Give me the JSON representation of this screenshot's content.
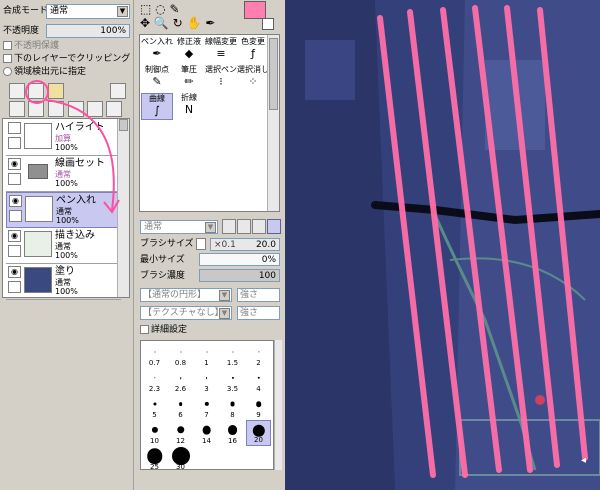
{
  "layer_panel": {
    "blend_mode_label": "合成モード",
    "blend_mode_value": "通常",
    "opacity_label": "不透明度",
    "opacity_value": "100%",
    "protect_opacity": "不透明保護",
    "clip_lower": "下のレイヤーでクリッピング",
    "selection_source": "領域検出元に指定",
    "layers": [
      {
        "name": "ハイライト",
        "mode": "加算",
        "opacity": "100%"
      },
      {
        "name": "線画セット",
        "mode": "通常",
        "opacity": "100%"
      },
      {
        "name": "ペン入れ",
        "mode": "通常",
        "opacity": "100%"
      },
      {
        "name": "描き込み",
        "mode": "通常",
        "opacity": "100%"
      },
      {
        "name": "塗り",
        "mode": "通常",
        "opacity": "100%"
      }
    ]
  },
  "tool_panel": {
    "tools": [
      {
        "label": "ペン入れ",
        "icon": "pen-icon"
      },
      {
        "label": "修正液",
        "icon": "correction-icon"
      },
      {
        "label": "線幅変更",
        "icon": "line-width-icon"
      },
      {
        "label": "色変更",
        "icon": "color-change-icon"
      },
      {
        "label": "制御点",
        "icon": "control-point-icon"
      },
      {
        "label": "筆圧",
        "icon": "pressure-icon"
      },
      {
        "label": "選択ペン",
        "icon": "select-pen-icon"
      },
      {
        "label": "選択消し",
        "icon": "select-erase-icon"
      },
      {
        "label": "曲線",
        "icon": "curve-icon"
      },
      {
        "label": "折線",
        "icon": "polyline-icon"
      }
    ],
    "mode_value": "通常",
    "brush_size_label": "ブラシサイズ",
    "brush_size_mult": "×0.1",
    "brush_size_value": "20.0",
    "min_size_label": "最小サイズ",
    "min_size_value": "0%",
    "density_label": "ブラシ濃度",
    "density_value": "100",
    "texture_shape": "【通常の円形】",
    "texture_paper": "【テクスチャなし】",
    "strength1": "強さ",
    "strength2": "強さ",
    "detail_settings": "詳細設定",
    "brush_sizes": [
      "0.7",
      "0.8",
      "1",
      "1.5",
      "2",
      "2.3",
      "2.6",
      "3",
      "3.5",
      "4",
      "5",
      "6",
      "7",
      "8",
      "9",
      "10",
      "12",
      "14",
      "16",
      "20",
      "25",
      "30"
    ]
  },
  "colors": {
    "accent": "#ff6fa8",
    "selection": "#c8c8f0",
    "swatch_fg": "#ff80b0"
  }
}
